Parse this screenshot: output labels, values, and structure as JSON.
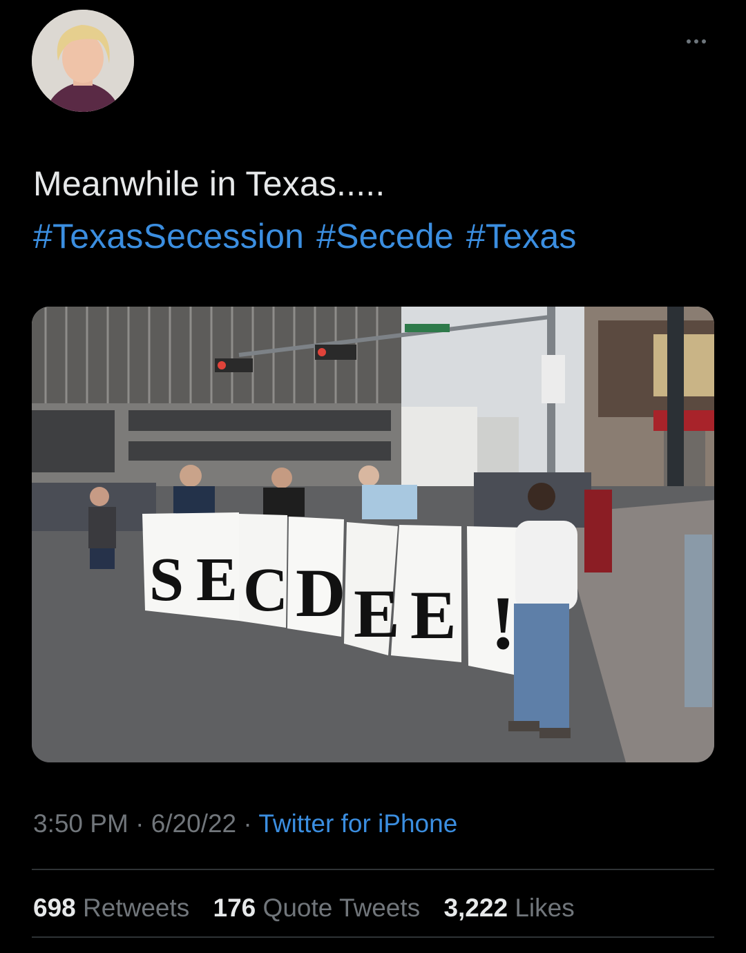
{
  "tweet": {
    "text_line1": "Meanwhile in Texas.....",
    "hashtags": [
      "#TexasSecession",
      "#Secede",
      "#Texas"
    ],
    "time": "3:50 PM",
    "date": "6/20/22",
    "source": "Twitter for iPhone",
    "photo_sign_letters": [
      "S",
      "E",
      "C",
      "D",
      "E",
      "E",
      "!"
    ]
  },
  "stats": {
    "retweets_count": "698",
    "retweets_label": "Retweets",
    "quotes_count": "176",
    "quotes_label": "Quote Tweets",
    "likes_count": "3,222",
    "likes_label": "Likes"
  },
  "colors": {
    "background": "#000000",
    "text": "#e7e9ea",
    "link": "#3b8ee0",
    "muted": "#71767b"
  }
}
